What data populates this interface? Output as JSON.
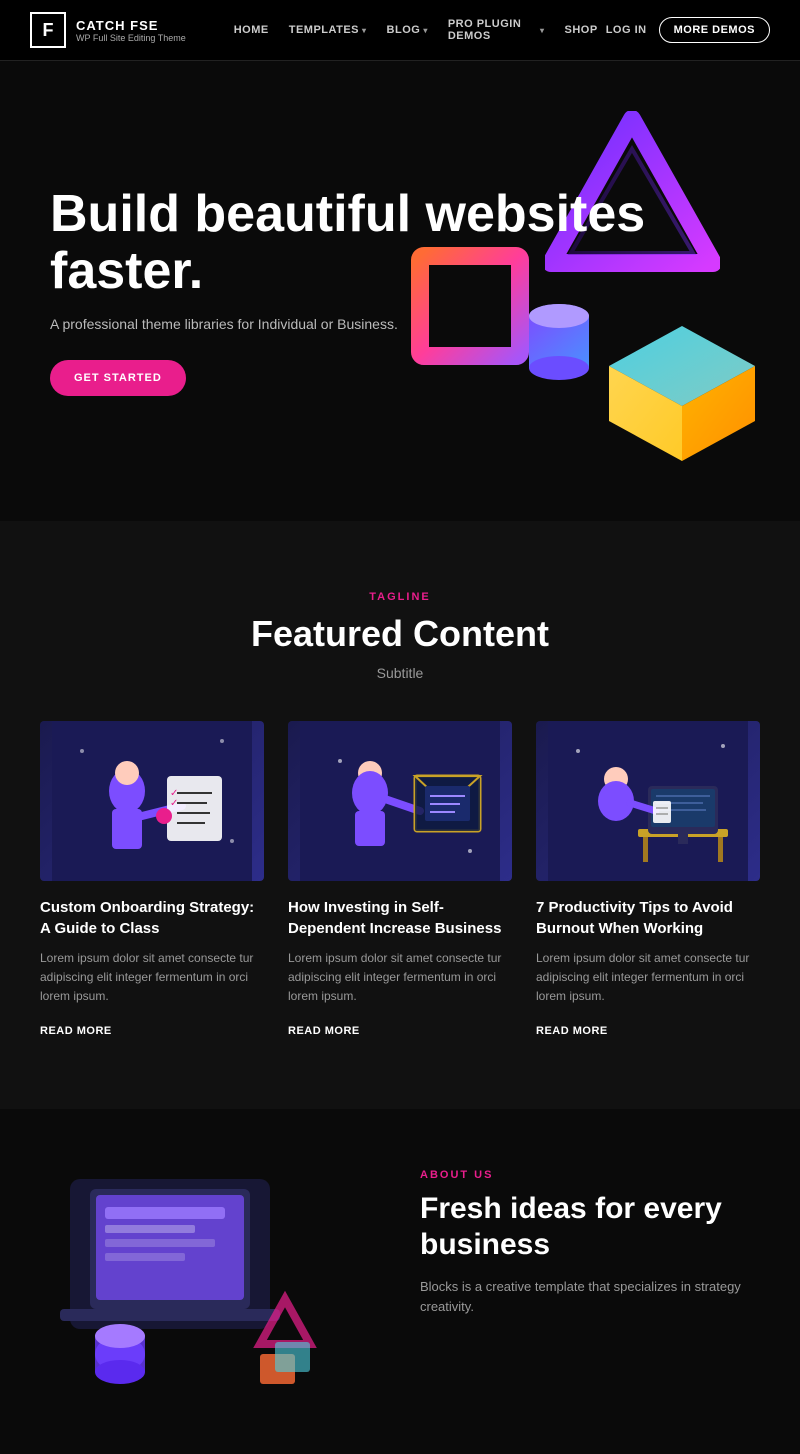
{
  "brand": {
    "icon": "F",
    "title": "CATCH FSE",
    "subtitle": "WP Full Site Editing Theme"
  },
  "nav": {
    "items": [
      {
        "label": "HOME",
        "hasArrow": false
      },
      {
        "label": "TEMPLATES",
        "hasArrow": true
      },
      {
        "label": "BLOG",
        "hasArrow": true
      },
      {
        "label": "PRO PLUGIN DEMOS",
        "hasArrow": true
      },
      {
        "label": "SHOP",
        "hasArrow": false
      }
    ],
    "login": "LOG IN",
    "moreDemos": "MORE DEMOS"
  },
  "hero": {
    "title": "Build beautiful websites faster.",
    "subtitle": "A professional theme libraries for Individual or Business.",
    "cta": "GET STARTED"
  },
  "featured": {
    "tagline": "TAGLINE",
    "title": "Featured Content",
    "subtitle": "Subtitle",
    "cards": [
      {
        "title": "Custom Onboarding Strategy: A Guide to Class",
        "text": "Lorem ipsum dolor sit amet consecte tur adipiscing elit integer fermentum in orci lorem ipsum.",
        "readMore": "READ MORE"
      },
      {
        "title": "How Investing in Self-Dependent Increase Business",
        "text": "Lorem ipsum dolor sit amet consecte tur adipiscing elit integer fermentum in orci lorem ipsum.",
        "readMore": "READ MORE"
      },
      {
        "title": "7 Productivity Tips to Avoid Burnout When Working",
        "text": "Lorem ipsum dolor sit amet consecte tur adipiscing elit integer fermentum in orci lorem ipsum.",
        "readMore": "READ MORE"
      }
    ]
  },
  "about": {
    "tagline": "ABOUT US",
    "title": "Fresh ideas for every business",
    "text": "Blocks is a creative template that specializes in strategy creativity."
  }
}
